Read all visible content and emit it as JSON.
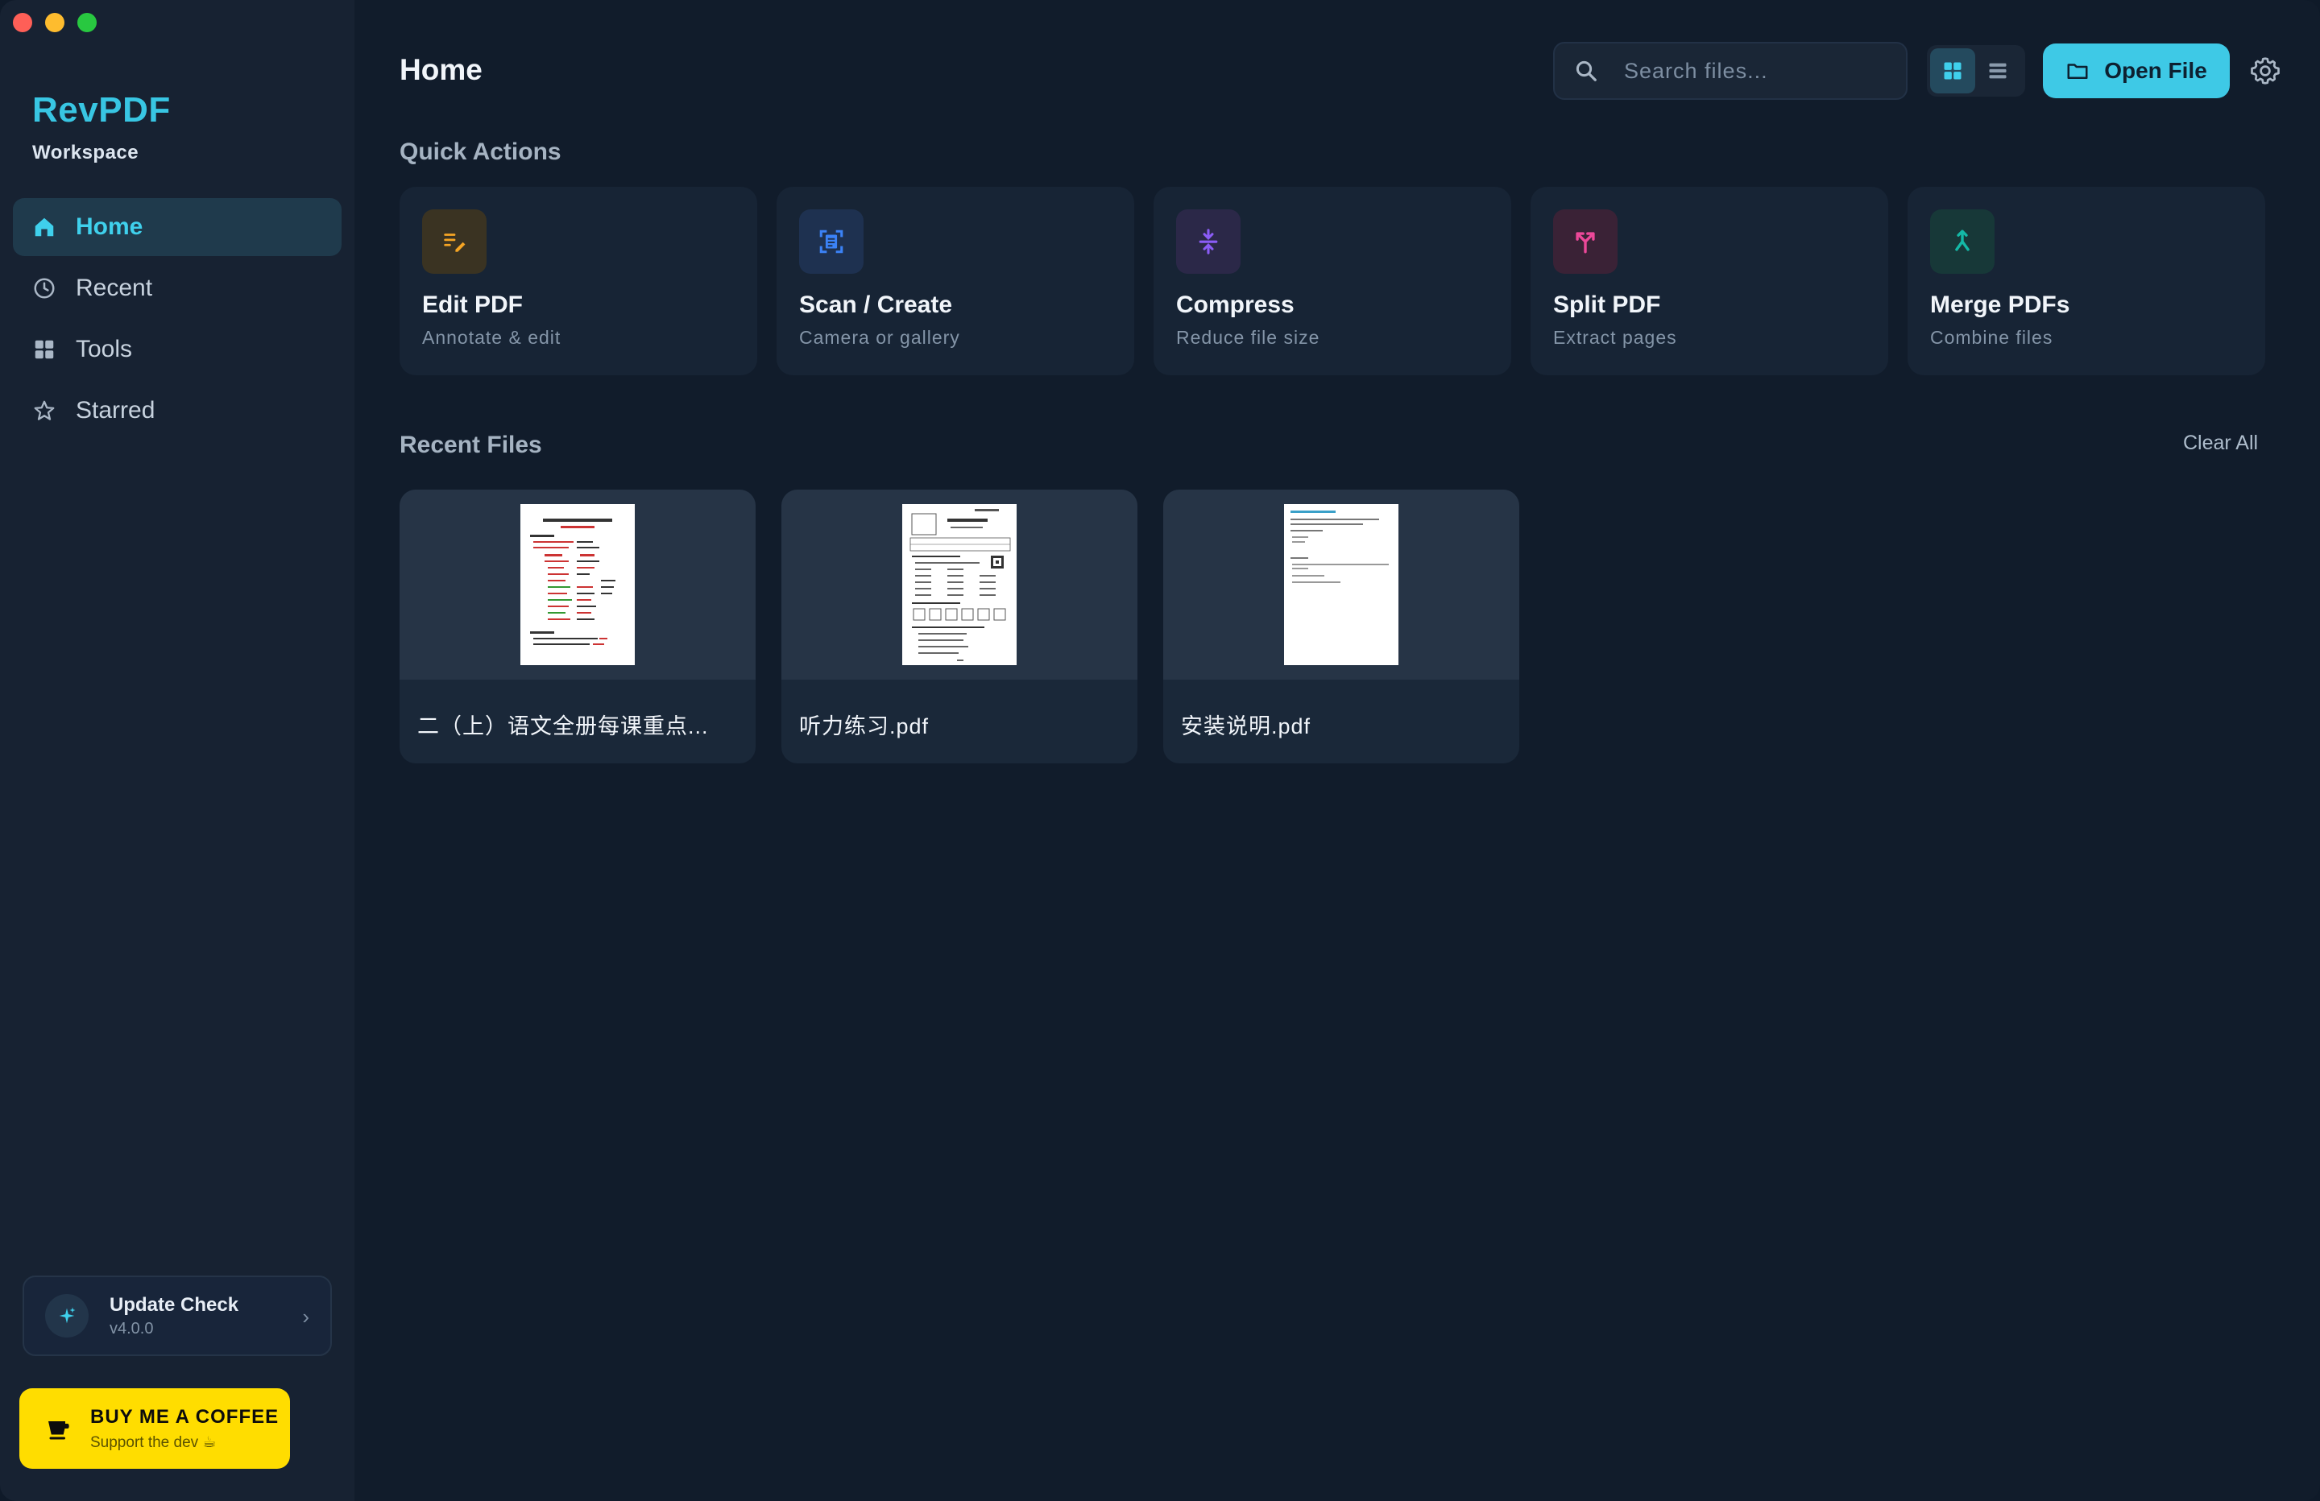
{
  "app": {
    "brand": "RevPDF",
    "workspace": "Workspace"
  },
  "sidebar": {
    "items": [
      {
        "label": "Home",
        "icon": "home-icon",
        "active": true
      },
      {
        "label": "Recent",
        "icon": "clock-icon",
        "active": false
      },
      {
        "label": "Tools",
        "icon": "grid-icon",
        "active": false
      },
      {
        "label": "Starred",
        "icon": "star-icon",
        "active": false
      }
    ],
    "update": {
      "title": "Update Check",
      "version": "v4.0.0"
    },
    "coffee": {
      "title": "BUY ME A COFFEE",
      "subtitle": "Support the dev ☕"
    }
  },
  "header": {
    "title": "Home",
    "search_placeholder": "Search files...",
    "open_label": "Open File"
  },
  "quick_actions": {
    "title": "Quick Actions",
    "items": [
      {
        "title": "Edit PDF",
        "subtitle": "Annotate & edit",
        "icon": "pencil-icon",
        "color": "#f5a524",
        "bg": "#3a3322"
      },
      {
        "title": "Scan / Create",
        "subtitle": "Camera or gallery",
        "icon": "scan-icon",
        "color": "#3b82f6",
        "bg": "#1e3150"
      },
      {
        "title": "Compress",
        "subtitle": "Reduce file size",
        "icon": "compress-icon",
        "color": "#8b5cf6",
        "bg": "#2b2848"
      },
      {
        "title": "Split PDF",
        "subtitle": "Extract pages",
        "icon": "split-icon",
        "color": "#ec4899",
        "bg": "#3a2236"
      },
      {
        "title": "Merge PDFs",
        "subtitle": "Combine files",
        "icon": "merge-icon",
        "color": "#14b8a6",
        "bg": "#173838"
      }
    ]
  },
  "recent": {
    "title": "Recent Files",
    "clear_label": "Clear All",
    "files": [
      {
        "name": "二（上）语文全册每课重点..."
      },
      {
        "name": "听力练习.pdf"
      },
      {
        "name": "安装说明.pdf"
      }
    ]
  },
  "colors": {
    "accent": "#3ec9e6",
    "coffee": "#ffdd00"
  }
}
